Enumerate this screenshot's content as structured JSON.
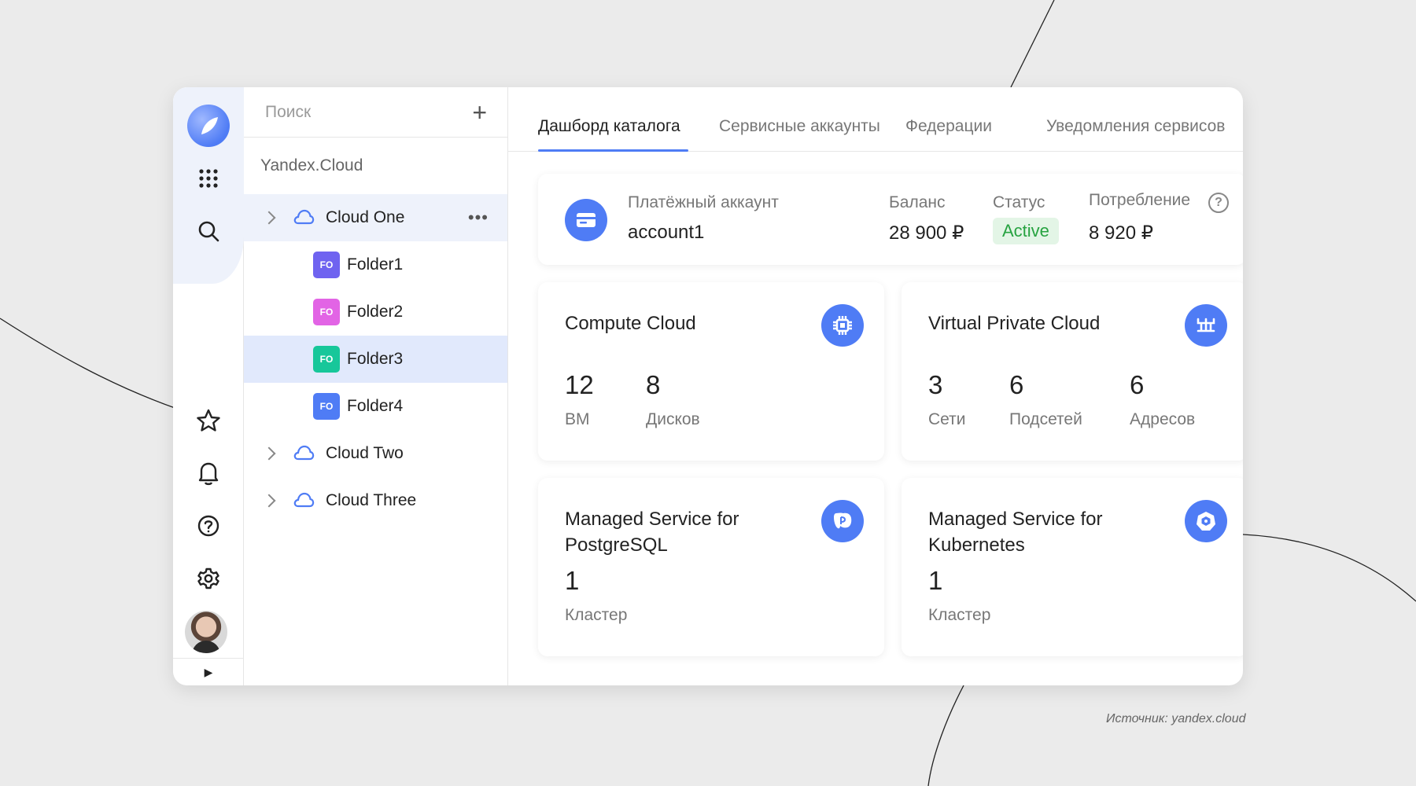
{
  "rail": {
    "icons": [
      "logo-icon",
      "apps-grid-icon",
      "search-icon",
      "star-icon",
      "bell-icon",
      "help-icon",
      "gear-icon",
      "avatar",
      "expand-icon"
    ],
    "accent": "#4f7cf5"
  },
  "tree": {
    "search_placeholder": "Поиск",
    "org": "Yandex.Cloud",
    "clouds": [
      {
        "label": "Cloud One",
        "folders": [
          {
            "badge": "FO",
            "label": "Folder1",
            "color": "#6f63f0"
          },
          {
            "badge": "FO",
            "label": "Folder2",
            "color": "#e264e5"
          },
          {
            "badge": "FO",
            "label": "Folder3",
            "color": "#17c79a"
          },
          {
            "badge": "FO",
            "label": "Folder4",
            "color": "#4f7cf5"
          }
        ]
      },
      {
        "label": "Cloud Two"
      },
      {
        "label": "Cloud Three"
      }
    ]
  },
  "tabs": [
    "Дашборд каталога",
    "Сервисные аккаунты",
    "Федерации",
    "Уведомления сервисов"
  ],
  "account": {
    "label": "Платёжный аккаунт",
    "name": "account1",
    "balance_label": "Баланс",
    "balance": "28 900 ₽",
    "status_label": "Статус",
    "status": "Active",
    "usage_label": "Потребление",
    "usage": "8 920 ₽",
    "help": "?"
  },
  "services": [
    {
      "title": "Compute Cloud",
      "icon": "chip-icon",
      "metrics": [
        {
          "value": "12",
          "label": "ВМ"
        },
        {
          "value": "8",
          "label": "Дисков"
        }
      ]
    },
    {
      "title": "Virtual Private Cloud",
      "icon": "network-icon",
      "metrics": [
        {
          "value": "3",
          "label": "Сети"
        },
        {
          "value": "6",
          "label": "Подсетей"
        },
        {
          "value": "6",
          "label": "Адресов"
        }
      ]
    },
    {
      "title": "Managed Service for PostgreSQL",
      "icon": "postgresql-icon",
      "metrics": [
        {
          "value": "1",
          "label": "Кластер"
        }
      ]
    },
    {
      "title": "Managed Service for Kubernetes",
      "icon": "kubernetes-icon",
      "metrics": [
        {
          "value": "1",
          "label": "Кластер"
        }
      ]
    }
  ],
  "source": "Источник: yandex.cloud"
}
